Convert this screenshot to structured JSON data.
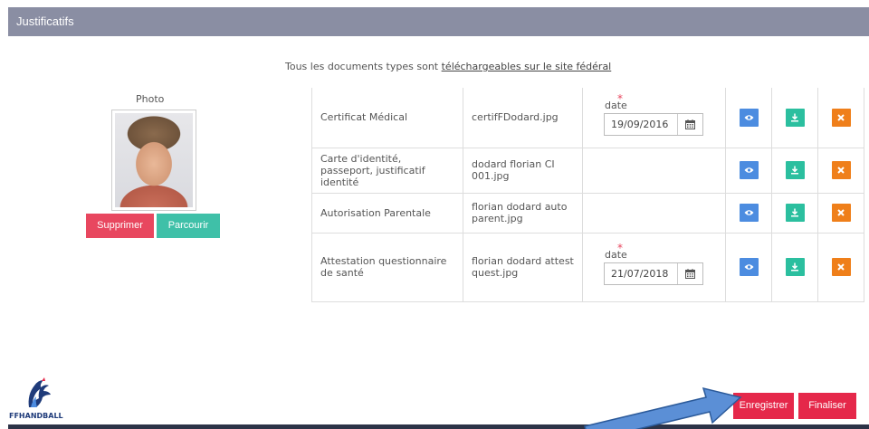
{
  "section": {
    "title": "Justificatifs"
  },
  "intro": {
    "text": "Tous les documents types sont ",
    "link": "téléchargeables sur le site fédéral"
  },
  "photo": {
    "label": "Photo",
    "delete_label": "Supprimer",
    "browse_label": "Parcourir"
  },
  "documents": [
    {
      "name": "Certificat Médical",
      "file": "certifFDodard.jpg",
      "date_label": "date",
      "date": "19/09/2016"
    },
    {
      "name": "Carte d'identité, passeport, justificatif identité",
      "file": "dodard florian CI 001.jpg",
      "date_label": "",
      "date": ""
    },
    {
      "name": "Autorisation Parentale",
      "file": "florian dodard auto parent.jpg",
      "date_label": "",
      "date": ""
    },
    {
      "name": "Attestation questionnaire de santé",
      "file": "florian dodard attest quest.jpg",
      "date_label": "date",
      "date": "21/07/2018"
    }
  ],
  "footer": {
    "logo_text": "FFHANDBALL",
    "save_label": "Enregistrer",
    "finish_label": "Finaliser"
  },
  "colors": {
    "header": "#8a8ea3",
    "danger": "#e5284a",
    "teal": "#3fc0a8",
    "view": "#4c8ce0",
    "download": "#2bbf9f",
    "remove": "#ef7f1a",
    "arrow": "#5b8fd6"
  },
  "icons": {
    "view": "eye-icon",
    "download": "download-icon",
    "remove": "close-icon",
    "calendar": "calendar-icon"
  }
}
